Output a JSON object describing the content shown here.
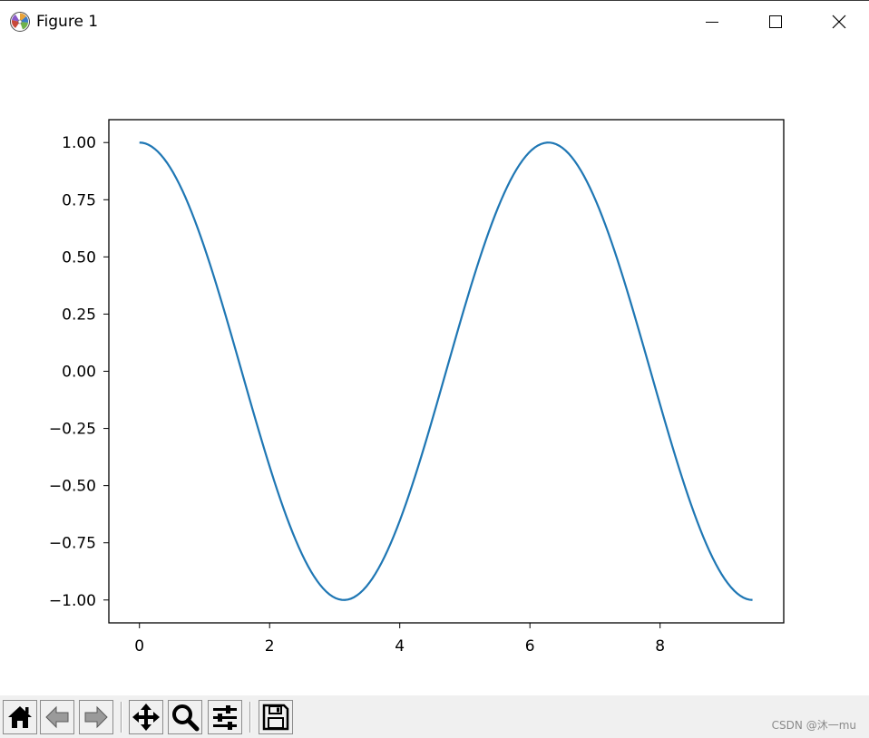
{
  "window": {
    "title": "Figure 1",
    "controls": {
      "minimize": "minimize",
      "maximize": "maximize",
      "close": "close"
    }
  },
  "toolbar": {
    "buttons": [
      {
        "id": "home",
        "icon": "home-icon"
      },
      {
        "id": "back",
        "icon": "arrow-left-icon"
      },
      {
        "id": "forward",
        "icon": "arrow-right-icon"
      },
      {
        "id": "pan",
        "icon": "move-icon"
      },
      {
        "id": "zoom",
        "icon": "magnifier-icon"
      },
      {
        "id": "configure",
        "icon": "sliders-icon"
      },
      {
        "id": "save",
        "icon": "floppy-disk-icon"
      }
    ]
  },
  "watermark": "CSDN @沐一mu",
  "colors": {
    "line": "#1f77b4",
    "toolbar_bg": "#f0f0f0",
    "axes": "#000000"
  },
  "chart_data": {
    "type": "line",
    "title": "",
    "xlabel": "",
    "ylabel": "",
    "xlim": [
      -0.47,
      9.9
    ],
    "ylim": [
      -1.1,
      1.1
    ],
    "xticks": [
      0,
      2,
      4,
      6,
      8
    ],
    "xtick_labels": [
      "0",
      "2",
      "4",
      "6",
      "8"
    ],
    "yticks": [
      1.0,
      0.75,
      0.5,
      0.25,
      0.0,
      -0.25,
      -0.5,
      -0.75,
      -1.0
    ],
    "ytick_labels": [
      "1.00",
      "0.75",
      "0.50",
      "0.25",
      "0.00",
      "−0.25",
      "−0.50",
      "−0.75",
      "−1.00"
    ],
    "grid": false,
    "series": [
      {
        "function": "cos(x)",
        "x_range": [
          0,
          9.42
        ],
        "x": [
          0,
          0.5,
          1,
          1.5,
          2,
          2.5,
          3,
          3.14,
          3.5,
          4,
          4.5,
          5,
          5.5,
          6,
          6.28,
          6.5,
          7,
          7.5,
          8,
          8.5,
          9,
          9.42
        ],
        "y": [
          1.0,
          0.878,
          0.54,
          0.071,
          -0.416,
          -0.801,
          -0.99,
          -1.0,
          -0.936,
          -0.654,
          -0.211,
          0.284,
          0.709,
          0.96,
          1.0,
          0.977,
          0.754,
          0.347,
          -0.146,
          -0.602,
          -0.911,
          -1.0
        ],
        "color": "#1f77b4"
      }
    ]
  }
}
